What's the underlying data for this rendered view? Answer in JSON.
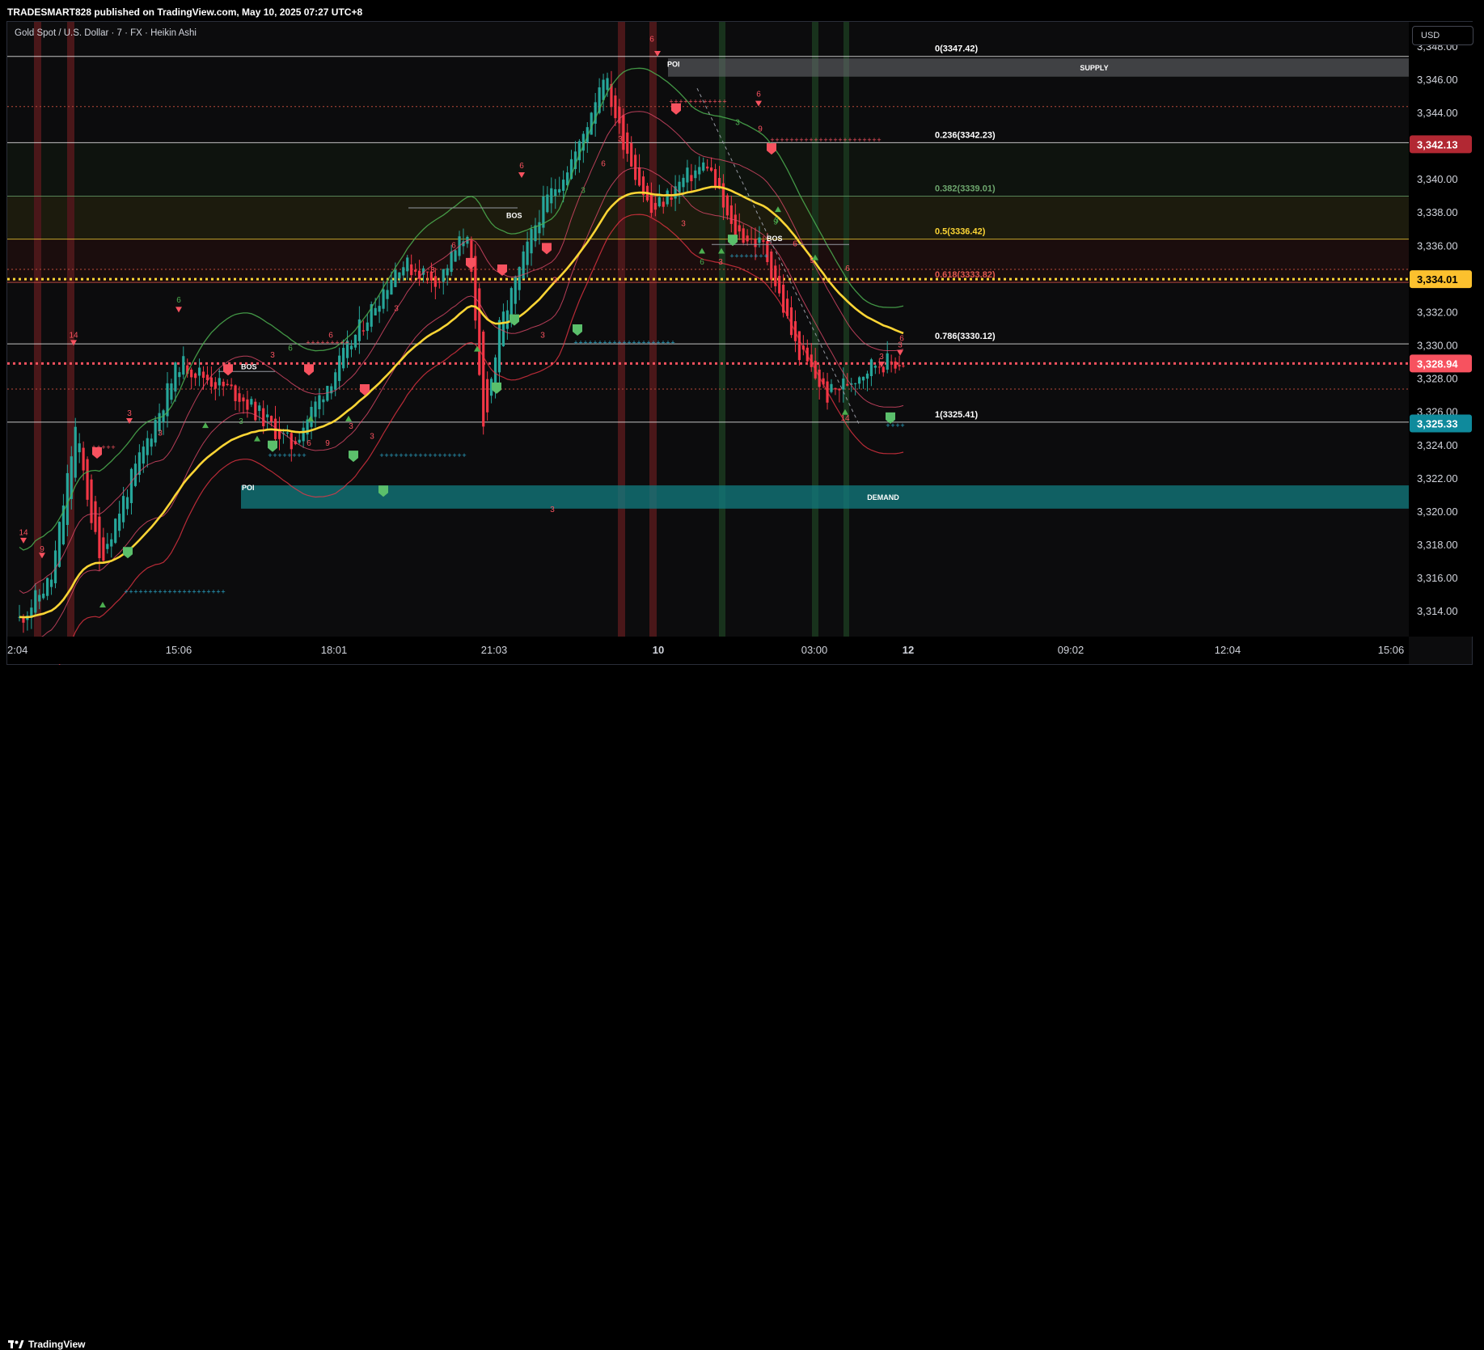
{
  "header": {
    "published_text": "TRADESMART828 published on TradingView.com, May 10, 2025 07:27 UTC+8"
  },
  "symbol": {
    "title": "Gold Spot / U.S. Dollar · 7 · FX · Heikin Ashi"
  },
  "currency_button": {
    "label": "USD"
  },
  "footer": {
    "brand": "TradingView",
    "logo_icon": "tradingview-logo-icon"
  },
  "colors": {
    "up": "#26a69a",
    "down": "#f23645",
    "ema": "#fcd535",
    "supply": "#9598a1",
    "demand": "#17a5a5",
    "upper_band": "#4caf50",
    "lower_band": "#f23645"
  },
  "chart_data": {
    "type": "candlestick",
    "style": "Heikin Ashi",
    "ylim": [
      3312.5,
      3349.5
    ],
    "y_ticks": [
      "3,314.00",
      "3,316.00",
      "3,318.00",
      "3,320.00",
      "3,322.00",
      "3,324.00",
      "3,326.00",
      "3,328.00",
      "3,330.00",
      "3,332.00",
      "3,334.00",
      "3,336.00",
      "3,338.00",
      "3,340.00",
      "3,342.00",
      "3,344.00",
      "3,346.00",
      "3,348.00"
    ],
    "y_tick_values": [
      3314,
      3316,
      3318,
      3320,
      3322,
      3324,
      3326,
      3328,
      3330,
      3332,
      3334,
      3336,
      3338,
      3340,
      3342,
      3344,
      3346,
      3348
    ],
    "x_ticks": [
      "2:04",
      "15:06",
      "18:01",
      "21:03",
      "10",
      "03:00",
      "12",
      "09:02",
      "12:04",
      "15:06"
    ],
    "price_labels": [
      {
        "text": "3,342.13",
        "value": 3342.13,
        "color": "#b22833"
      },
      {
        "text": "3,334.01",
        "value": 3334.01,
        "color": "#fcc12e"
      },
      {
        "text": "3,328.94",
        "value": 3328.94,
        "color": "#f7525f"
      },
      {
        "text": "3,325.33",
        "value": 3325.33,
        "color": "#0f8a9c"
      }
    ],
    "fib_levels": [
      {
        "label": "0(3347.42)",
        "value": 3347.42,
        "color": "#ffffff"
      },
      {
        "label": "0.236(3342.23)",
        "value": 3342.23,
        "color": "#ffffff"
      },
      {
        "label": "0.382(3339.01)",
        "value": 3339.01,
        "color": "#6da66d"
      },
      {
        "label": "0.5(3336.42)",
        "value": 3336.42,
        "color": "#fcd535"
      },
      {
        "label": "0.618(3333.82)",
        "value": 3333.82,
        "color": "#e0574f"
      },
      {
        "label": "0.786(3330.12)",
        "value": 3330.12,
        "color": "#ffffff"
      },
      {
        "label": "1(3325.41)",
        "value": 3325.41,
        "color": "#ffffff"
      }
    ],
    "zones": [
      {
        "label": "SUPPLY",
        "from": 3346.2,
        "to": 3347.3
      },
      {
        "label": "DEMAND",
        "from": 3320.2,
        "to": 3321.6
      }
    ],
    "annotations": [
      "POI",
      "POI",
      "BOS",
      "BOS",
      "BOS"
    ],
    "signal_numbers": [
      "14",
      "6",
      "9",
      "3",
      "3",
      "3",
      "6",
      "14",
      "6",
      "3",
      "6",
      "3",
      "3",
      "6",
      "3",
      "9",
      "3",
      "3",
      "6",
      "3",
      "3",
      "3",
      "6",
      "9",
      "3",
      "3",
      "6",
      "3",
      "6",
      "9",
      "6",
      "3",
      "3",
      "6",
      "6",
      "6",
      "9",
      "3",
      "3",
      "14"
    ]
  }
}
